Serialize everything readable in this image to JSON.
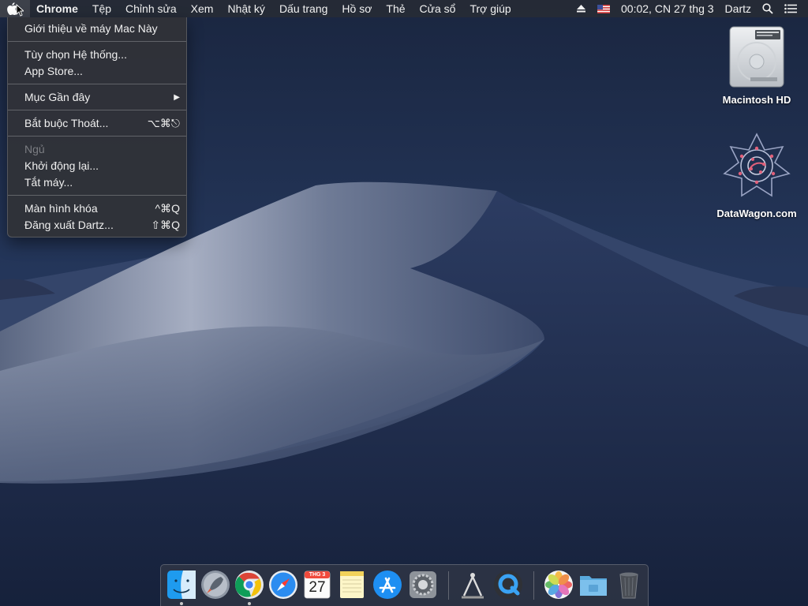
{
  "menubar": {
    "app_name": "Chrome",
    "items": [
      "Tệp",
      "Chỉnh sửa",
      "Xem",
      "Nhật ký",
      "Dấu trang",
      "Hồ sơ",
      "Thẻ",
      "Cửa sổ",
      "Trợ giúp"
    ],
    "clock": "00:02, CN 27 thg 3",
    "user": "Dartz",
    "icons": [
      "apple-icon",
      "eject-icon",
      "us-flag-icon",
      "spotlight-search-icon",
      "notification-center-icon"
    ]
  },
  "apple_menu": {
    "about": "Giới thiệu về máy Mac Này",
    "system_prefs": "Tùy chọn Hệ thống...",
    "app_store": "App Store...",
    "recent_items": "Mục Gần đây",
    "force_quit": "Bắt buộc Thoát...",
    "force_quit_shortcut": "⌥⌘⎋",
    "sleep": "Ngủ",
    "restart": "Khởi động lại...",
    "shutdown": "Tắt máy...",
    "lock_screen": "Màn hình khóa",
    "lock_screen_shortcut": "^⌘Q",
    "logout": "Đăng xuất Dartz...",
    "logout_shortcut": "⇧⌘Q"
  },
  "desktop": {
    "icons": [
      {
        "label": "Macintosh HD",
        "icon": "hard-drive-icon"
      },
      {
        "label": "DataWagon.com",
        "icon": "datawagon-icon"
      }
    ]
  },
  "dock": {
    "calendar_month": "THG 3",
    "calendar_day": "27",
    "apps": [
      "Finder",
      "Launchpad",
      "Google Chrome",
      "Safari",
      "Calendar",
      "Notes",
      "App Store",
      "System Preferences",
      "Screenshot Utility",
      "QuickTime Player",
      "Photos",
      "Downloads Folder",
      "Trash"
    ]
  },
  "colors": {
    "menubar_bg": "#2c3038",
    "menu_bg": "#303238",
    "wallpaper_sky": "#1d2a44",
    "dune_light": "#9aa3b8"
  }
}
